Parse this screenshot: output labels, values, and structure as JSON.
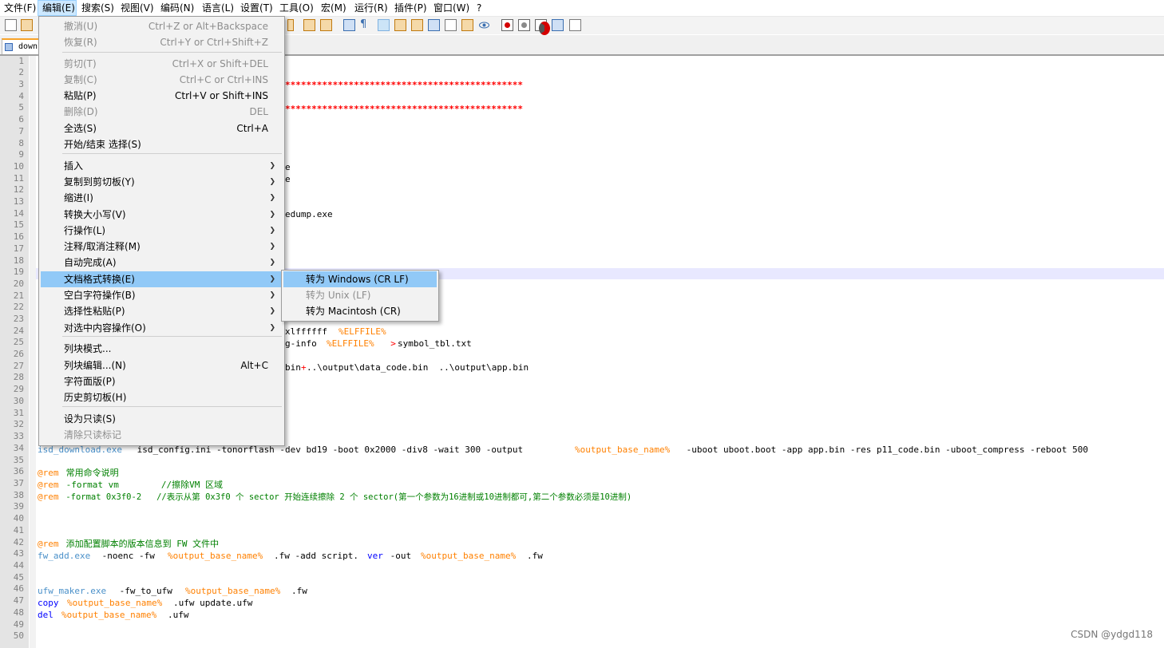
{
  "menubar": {
    "items": [
      "文件(F)",
      "编辑(E)",
      "搜索(S)",
      "视图(V)",
      "编码(N)",
      "语言(L)",
      "设置(T)",
      "工具(O)",
      "宏(M)",
      "运行(R)",
      "插件(P)",
      "窗口(W)",
      "?"
    ]
  },
  "tab": {
    "label": "downl"
  },
  "editor": {
    "line_numbers": [
      "1",
      "2",
      "3",
      "4",
      "5",
      "6",
      "7",
      "8",
      "9",
      "10",
      "11",
      "12",
      "13",
      "14",
      "15",
      "16",
      "17",
      "18",
      "19",
      "20",
      "21",
      "22",
      "23",
      "24",
      "25",
      "26",
      "27",
      "28",
      "29",
      "30",
      "31",
      "32",
      "33",
      "34",
      "35",
      "36",
      "37",
      "38",
      "39",
      "40",
      "41",
      "42",
      "43",
      "44",
      "45",
      "46",
      "47",
      "48",
      "49",
      "50"
    ],
    "partials": {
      "l3": "*********************************************",
      "l5": "*********************************************",
      "l10": "e",
      "l11": "e",
      "l13": "edump.exe",
      "l24_a": "xlffffff ",
      "l24_b": "%ELFFILE%",
      "l25_a": "g-info ",
      "l25_b": "%ELFFILE%",
      "l25_c": "  >",
      "l25_d": "symbol_tbl.txt",
      "l27_a": "bin",
      "l27_b": "+",
      "l27_c": "..\\output\\data_code.bin  ..\\output\\app.bin"
    },
    "l34": {
      "cmd": "isd_download.exe",
      "a": " isd_config.ini -tonorflash -dev bd19 -boot 0x2000 -div8 -wait 300 -output ",
      "var": "%output_base_name%",
      "b": " -uboot uboot.boot -app app.bin -res p11_code.bin -uboot_compress -reboot 500"
    },
    "l36": {
      "kw": "@rem",
      "text": " 常用命令说明"
    },
    "l37": {
      "kw": "@rem",
      "text": " -format vm        //擦除VM 区域"
    },
    "l38": {
      "kw": "@rem",
      "text": " -format 0x3f0-2   //表示从第 0x3f0 个 sector 开始连续擦除 2 个 sector(第一个参数为16进制或10进制都可,第二个参数必须是10进制)"
    },
    "l42": {
      "kw": "@rem",
      "text": " 添加配置脚本的版本信息到 FW 文件中"
    },
    "l43": {
      "cmd": "fw_add.exe",
      "a": " -noenc -fw ",
      "var": "%output_base_name%",
      "b": ".fw -add script.",
      "kw": "ver",
      "c": " -out ",
      "var2": "%output_base_name%",
      "d": ".fw"
    },
    "l46": {
      "cmd": "ufw_maker.exe",
      "a": " -fw_to_ufw ",
      "var": "%output_base_name%",
      "b": ".fw"
    },
    "l47": {
      "kw": "copy",
      "a": " ",
      "var": "%output_base_name%",
      "b": ".ufw update.ufw"
    },
    "l48": {
      "kw": "del",
      "a": " ",
      "var": "%output_base_name%",
      "b": ".ufw"
    }
  },
  "edit_menu": {
    "items": [
      {
        "label": "撤消(U)",
        "shortcut": "Ctrl+Z or Alt+Backspace",
        "disabled": true
      },
      {
        "label": "恢复(R)",
        "shortcut": "Ctrl+Y or Ctrl+Shift+Z",
        "disabled": true
      },
      {
        "label": "剪切(T)",
        "shortcut": "Ctrl+X or Shift+DEL",
        "disabled": true
      },
      {
        "label": "复制(C)",
        "shortcut": "Ctrl+C or Ctrl+INS",
        "disabled": true
      },
      {
        "label": "粘贴(P)",
        "shortcut": "Ctrl+V or Shift+INS",
        "disabled": false
      },
      {
        "label": "删除(D)",
        "shortcut": "DEL",
        "disabled": true
      },
      {
        "label": "全选(S)",
        "shortcut": "Ctrl+A",
        "disabled": false
      },
      {
        "label": "开始/结束 选择(S)",
        "shortcut": "",
        "disabled": false
      },
      {
        "label": "插入",
        "shortcut": "",
        "submenu": true
      },
      {
        "label": "复制到剪切板(Y)",
        "shortcut": "",
        "submenu": true
      },
      {
        "label": "缩进(I)",
        "shortcut": "",
        "submenu": true
      },
      {
        "label": "转换大小写(V)",
        "shortcut": "",
        "submenu": true
      },
      {
        "label": "行操作(L)",
        "shortcut": "",
        "submenu": true
      },
      {
        "label": "注释/取消注释(M)",
        "shortcut": "",
        "submenu": true
      },
      {
        "label": "自动完成(A)",
        "shortcut": "",
        "submenu": true
      },
      {
        "label": "文档格式转换(E)",
        "shortcut": "",
        "submenu": true,
        "selected": true
      },
      {
        "label": "空白字符操作(B)",
        "shortcut": "",
        "submenu": true
      },
      {
        "label": "选择性粘贴(P)",
        "shortcut": "",
        "submenu": true
      },
      {
        "label": "对选中内容操作(O)",
        "shortcut": "",
        "submenu": true
      },
      {
        "label": "列块模式...",
        "shortcut": ""
      },
      {
        "label": "列块编辑...(N)",
        "shortcut": "Alt+C"
      },
      {
        "label": "字符面版(P)",
        "shortcut": ""
      },
      {
        "label": "历史剪切板(H)",
        "shortcut": ""
      },
      {
        "label": "设为只读(S)",
        "shortcut": ""
      },
      {
        "label": "清除只读标记",
        "shortcut": "",
        "disabled": true
      }
    ]
  },
  "eol_submenu": {
    "items": [
      {
        "label": "转为 Windows (CR LF)",
        "selected": true
      },
      {
        "label": "转为 Unix (LF)",
        "disabled": true
      },
      {
        "label": "转为 Macintosh (CR)"
      }
    ]
  },
  "watermark": "CSDN @ydgd118",
  "colors": {
    "selection": "#91c9f7",
    "string_var": "#ff8000",
    "command": "#4a90c9",
    "keyword": "#0000ff",
    "comment": "#008000",
    "star": "#ff0000"
  }
}
